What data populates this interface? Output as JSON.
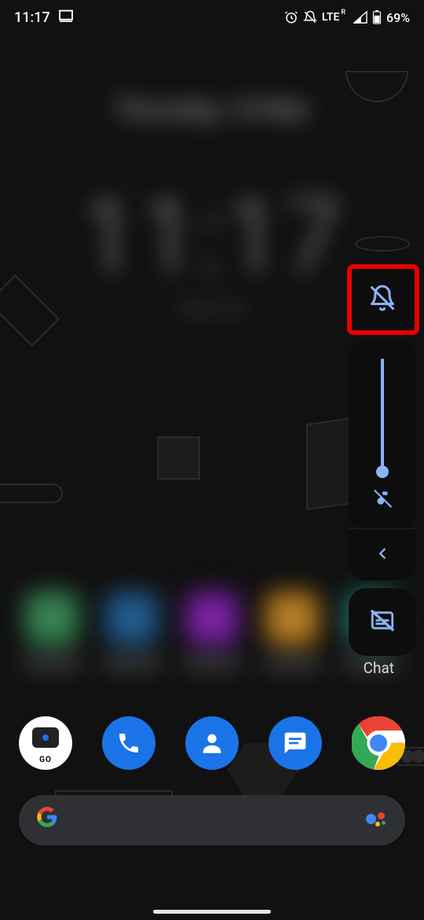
{
  "status": {
    "time": "11:17",
    "lte_label": "LTE",
    "roaming_label": "R",
    "battery_pct": "69%"
  },
  "home_blur": {
    "date": "Thursday, 10 Mar",
    "clock": "11:17",
    "sub": "Alarm set"
  },
  "peek": {
    "chat_label": "Chat"
  },
  "dock": {
    "camera_go": "GO"
  },
  "volume_panel": {
    "ringer_mode": "silent",
    "media_muted": true,
    "slider_value": 0,
    "captions_enabled": false
  },
  "colors": {
    "accent": "#8ab4f8",
    "highlight": "#e60000",
    "google_blue": "#1b73e8"
  }
}
